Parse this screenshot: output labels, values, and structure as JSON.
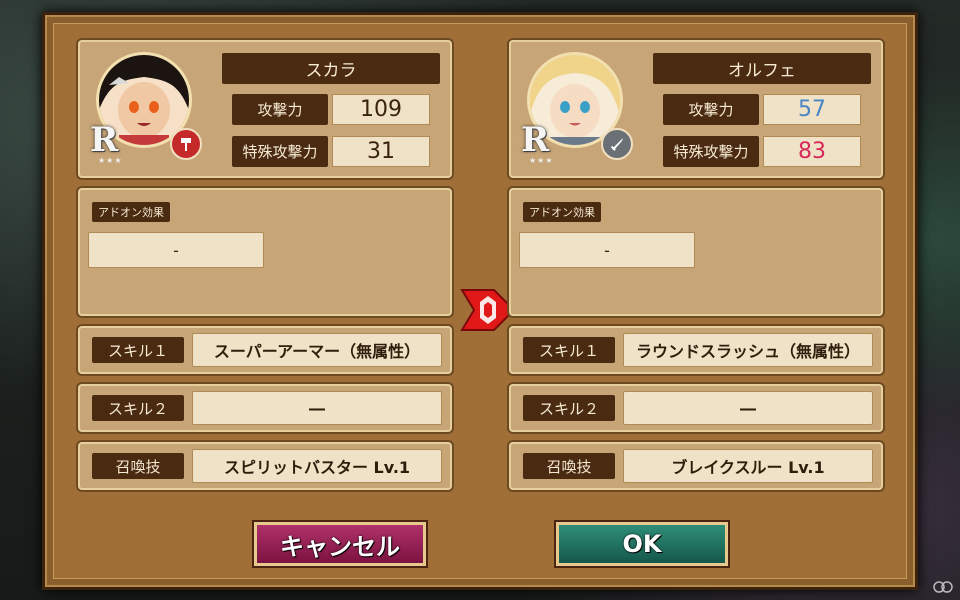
{
  "left": {
    "name": "スカラ",
    "rarity": "R",
    "stars": "★★★",
    "stats": [
      {
        "label": "攻撃力",
        "value": "109"
      },
      {
        "label": "特殊攻撃力",
        "value": "31"
      }
    ],
    "addon_label": "アドオン効果",
    "addon_value": "-",
    "skills": [
      {
        "label": "スキル１",
        "value": "スーパーアーマー（無属性）"
      },
      {
        "label": "スキル２",
        "value": "―"
      },
      {
        "label": "召喚技",
        "value": "スピリットバスター Lv.1"
      }
    ]
  },
  "right": {
    "name": "オルフェ",
    "rarity": "R",
    "stars": "★★★",
    "stats": [
      {
        "label": "攻撃力",
        "value": "57",
        "color": "#4a86c4"
      },
      {
        "label": "特殊攻撃力",
        "value": "83",
        "color": "#d8285a"
      }
    ],
    "addon_label": "アドオン効果",
    "addon_value": "-",
    "skills": [
      {
        "label": "スキル１",
        "value": "ラウンドスラッシュ（無属性）"
      },
      {
        "label": "スキル２",
        "value": "―"
      },
      {
        "label": "召喚技",
        "value": "ブレイクスルー Lv.1"
      }
    ]
  },
  "buttons": {
    "cancel": "キャンセル",
    "ok": "OK"
  },
  "colors": {
    "increase": "#4a86c4",
    "decrease": "#d8285a",
    "arrow": "#e01818"
  }
}
